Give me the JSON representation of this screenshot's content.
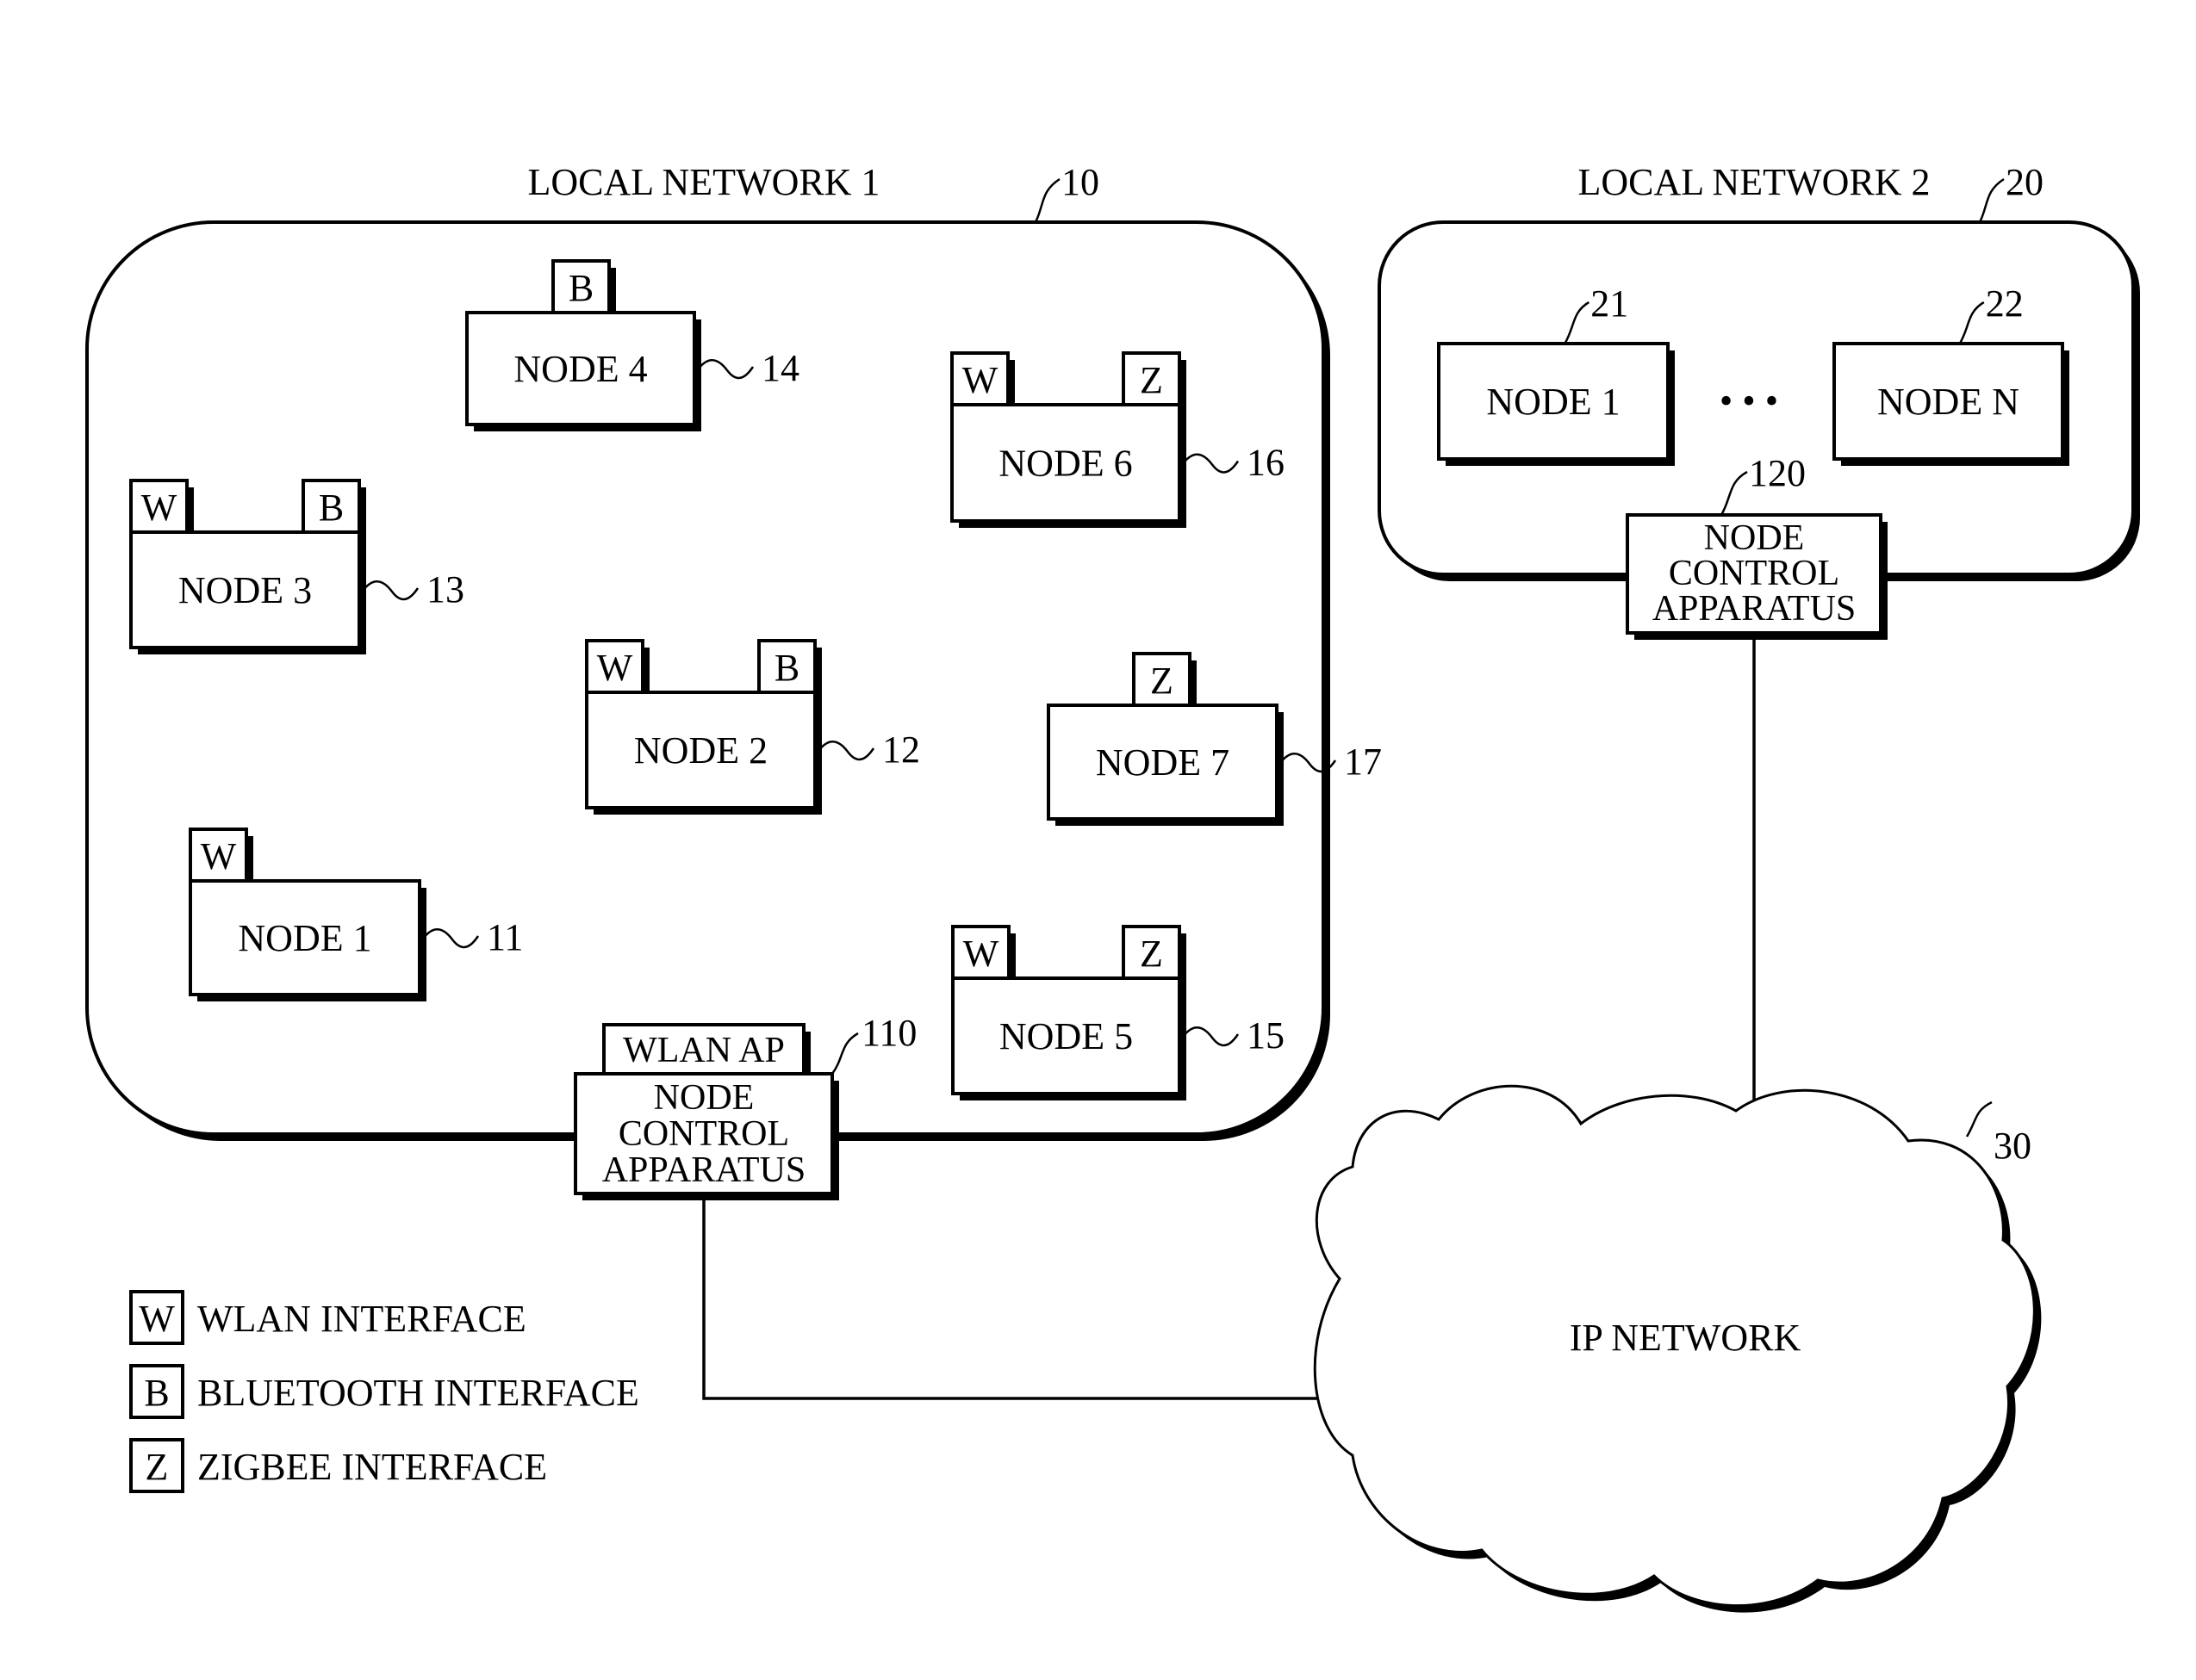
{
  "figure": {
    "local_network_1": {
      "title": "LOCAL NETWORK 1",
      "ref": "10",
      "nodes": [
        {
          "label": "NODE 4",
          "ref": "14",
          "interfaces": [
            "B"
          ]
        },
        {
          "label": "NODE 6",
          "ref": "16",
          "interfaces": [
            "W",
            "Z"
          ]
        },
        {
          "label": "NODE 3",
          "ref": "13",
          "interfaces": [
            "W",
            "B"
          ]
        },
        {
          "label": "NODE 2",
          "ref": "12",
          "interfaces": [
            "W",
            "B"
          ]
        },
        {
          "label": "NODE 7",
          "ref": "17",
          "interfaces": [
            "Z"
          ]
        },
        {
          "label": "NODE 1",
          "ref": "11",
          "interfaces": [
            "W"
          ]
        },
        {
          "label": "NODE 5",
          "ref": "15",
          "interfaces": [
            "W",
            "Z"
          ]
        }
      ],
      "controller": {
        "lines": [
          "NODE",
          "CONTROL",
          "APPARATUS"
        ],
        "ap_label": "WLAN AP",
        "ref": "110"
      }
    },
    "local_network_2": {
      "title": "LOCAL NETWORK 2",
      "ref": "20",
      "nodes": [
        {
          "label": "NODE 1",
          "ref": "21"
        },
        {
          "label": "NODE N",
          "ref": "22"
        }
      ],
      "ellipsis": "• • •",
      "controller": {
        "lines": [
          "NODE",
          "CONTROL",
          "APPARATUS"
        ],
        "ref": "120"
      }
    },
    "ip_network": {
      "label": "IP NETWORK",
      "ref": "30"
    },
    "legend": [
      {
        "symbol": "W",
        "label": "WLAN INTERFACE"
      },
      {
        "symbol": "B",
        "label": "BLUETOOTH INTERFACE"
      },
      {
        "symbol": "Z",
        "label": "ZIGBEE INTERFACE"
      }
    ]
  }
}
